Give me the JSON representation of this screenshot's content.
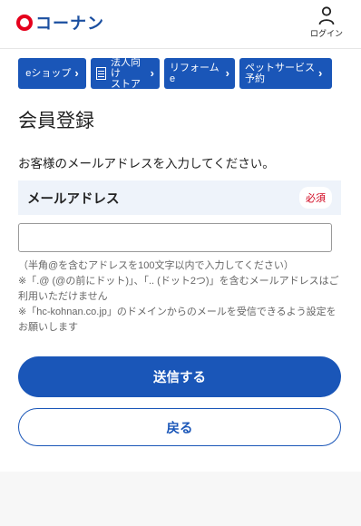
{
  "header": {
    "logo_text": "コーナン",
    "login_label": "ログイン"
  },
  "nav": {
    "items": [
      {
        "label": "eショップ"
      },
      {
        "label_line1": "法人向け",
        "label_line2": "ストア"
      },
      {
        "label": "リフォームe"
      },
      {
        "label_line1": "ペットサービス",
        "label_line2": "予約"
      }
    ]
  },
  "page": {
    "title": "会員登録",
    "lead": "お客様のメールアドレスを入力してください。"
  },
  "form": {
    "email_label": "メールアドレス",
    "required_badge": "必須",
    "email_value": "",
    "email_placeholder": "",
    "notes": [
      "（半角@を含むアドレスを100文字以内で入力してください）",
      "※「.@ (@の前にドット)」、「.. (ドット2つ)」を含むメールアドレスはご利用いただけません",
      "※「hc-kohnan.co.jp」のドメインからのメールを受信できるよう設定をお願いします"
    ],
    "submit_label": "送信する",
    "back_label": "戻る"
  },
  "colors": {
    "brand_blue": "#1a56b8",
    "logo_red": "#e5001c",
    "required_red": "#d0021b"
  }
}
